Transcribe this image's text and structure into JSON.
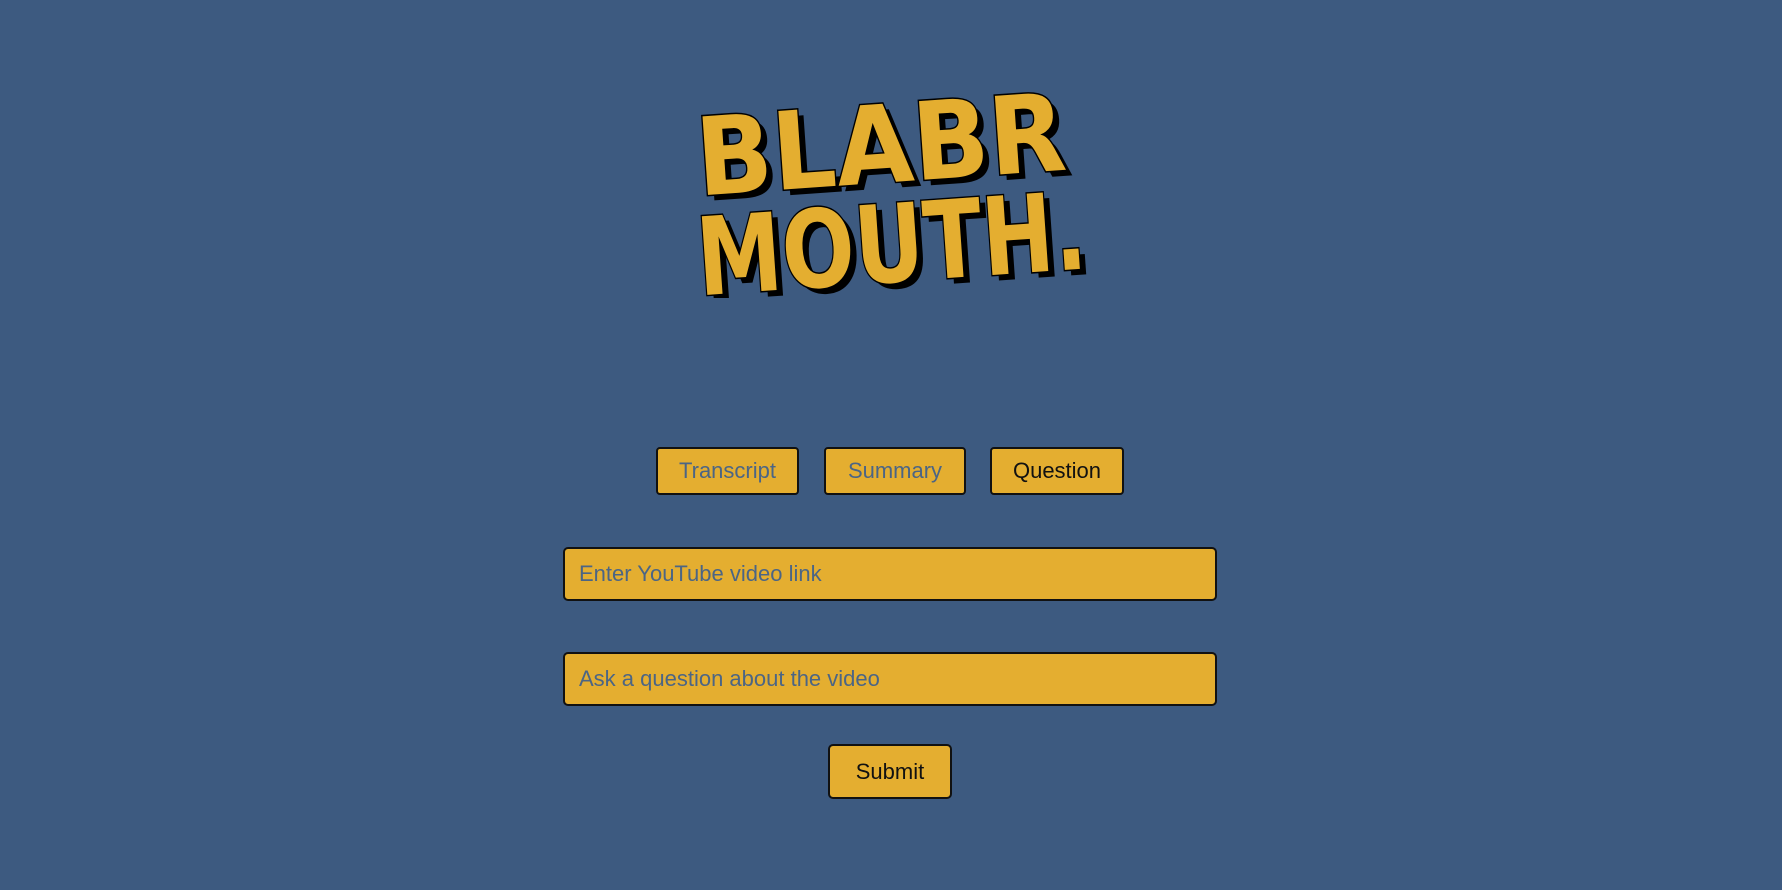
{
  "logo": {
    "line1": "BLABR",
    "line2": "MOUTH."
  },
  "tabs": [
    {
      "label": "Transcript",
      "active": false
    },
    {
      "label": "Summary",
      "active": false
    },
    {
      "label": "Question",
      "active": true
    }
  ],
  "video_input": {
    "value": "",
    "placeholder": "Enter YouTube video link"
  },
  "question_input": {
    "value": "",
    "placeholder": "Ask a question about the video"
  },
  "submit": {
    "label": "Submit"
  },
  "colors": {
    "background": "#3d5a80",
    "accent": "#e4ae30",
    "border": "#111111",
    "muted_text": "#4b6585"
  }
}
